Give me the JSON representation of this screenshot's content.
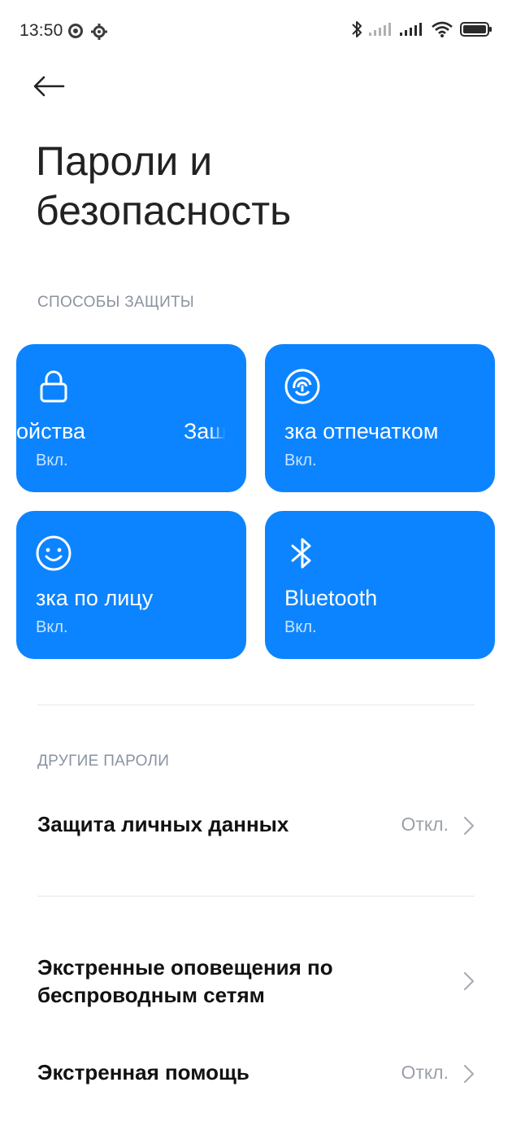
{
  "status_bar": {
    "time": "13:50"
  },
  "header": {
    "title": "Пароли и безопасность"
  },
  "sections": {
    "protection": "СПОСОБЫ ЗАЩИТЫ",
    "other": "ДРУГИЕ ПАРОЛИ"
  },
  "tiles": [
    {
      "title_part1": "ойства",
      "title_part2": "Защ",
      "status": "Вкл.",
      "icon": "lock-icon"
    },
    {
      "title": "зка отпечатком",
      "status": "Вкл.",
      "icon": "fingerprint-icon"
    },
    {
      "title": "зка по лицу",
      "status": "Вкл.",
      "icon": "face-icon"
    },
    {
      "title": "Bluetooth",
      "status": "Вкл.",
      "icon": "bluetooth-icon"
    }
  ],
  "rows": [
    {
      "title": "Защита личных данных",
      "value": "Откл."
    },
    {
      "title": "Экстренные оповещения по беспроводным сетям",
      "value": ""
    },
    {
      "title": "Экстренная помощь",
      "value": "Откл."
    }
  ],
  "colors": {
    "tile_blue": "#0d84ff",
    "section_header": "#8a93a0",
    "value_gray": "#9aa0a8"
  }
}
